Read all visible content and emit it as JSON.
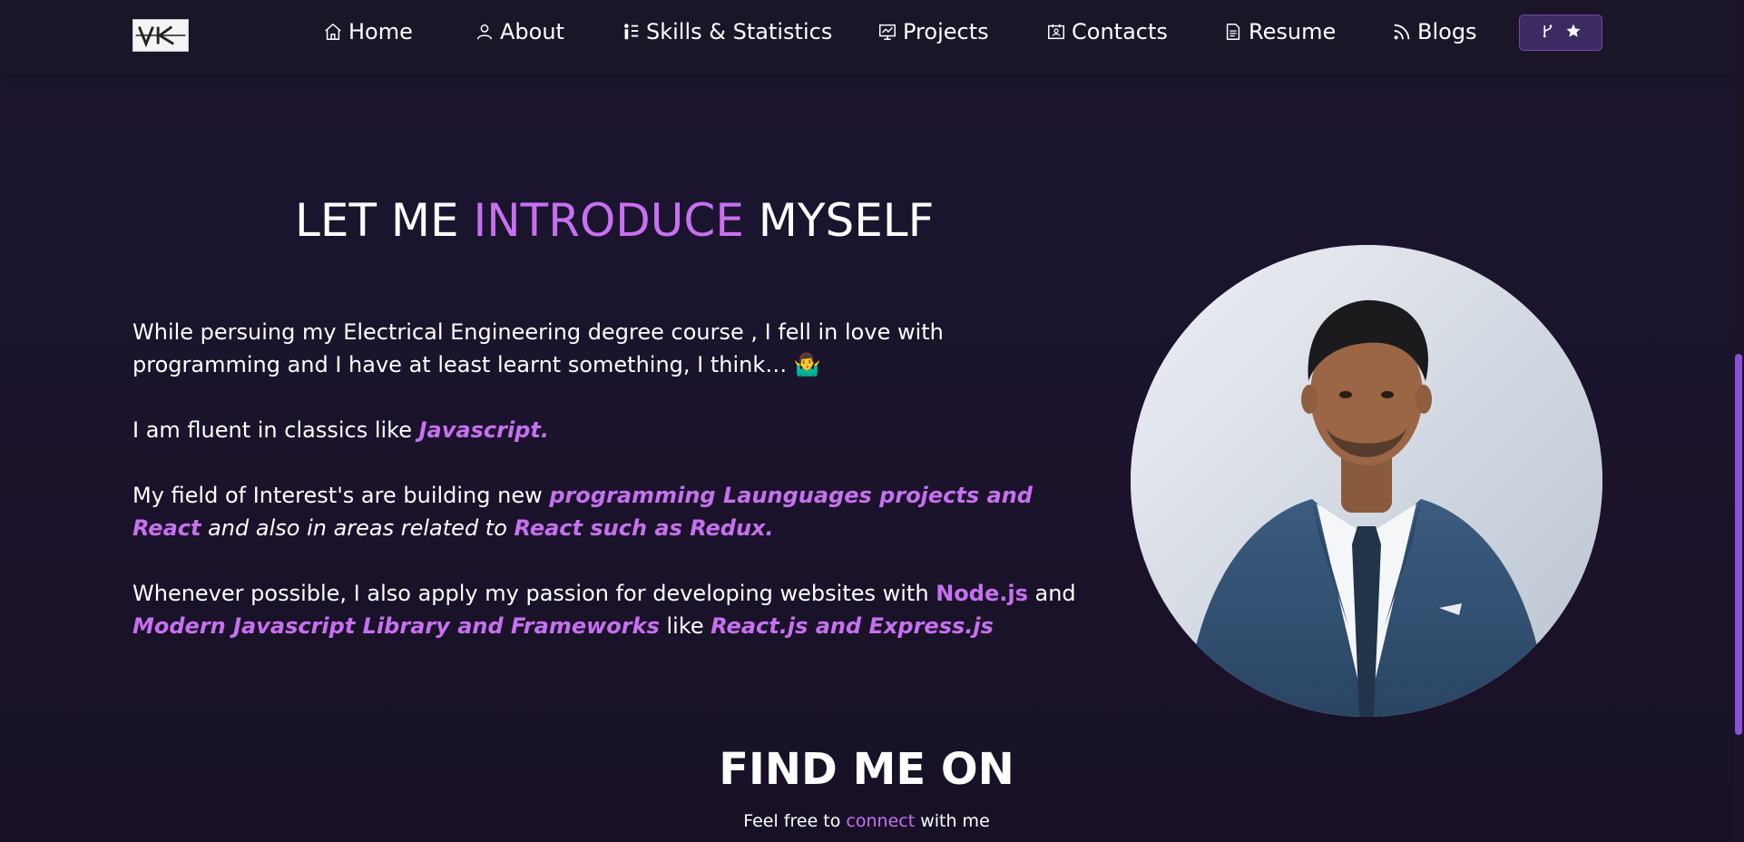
{
  "nav": {
    "home": "Home",
    "about": "About",
    "skills": "Skills & Statistics",
    "projects": "Projects",
    "contacts": "Contacts",
    "resume": "Resume",
    "blogs": "Blogs"
  },
  "intro": {
    "title_part1": "LET ME ",
    "title_highlight": "INTRODUCE",
    "title_part2": " MYSELF",
    "p1": "While persuing my Electrical Engineering degree course , I fell in love with programming and I have at least learnt something, I think… 🤷‍♂️",
    "p2_lead": "I am fluent in classics like ",
    "p2_highlight": "Javascript.",
    "p3_lead": "My field of Interest's are building new ",
    "p3_highlight1": "programming Launguages projects and React",
    "p3_mid": " and also in areas related to ",
    "p3_highlight2": "React such as Redux.",
    "p4_lead": "Whenever possible, I also apply my passion for developing websites with ",
    "p4_node": "Node.js",
    "p4_and": " and ",
    "p4_highlight1": "Modern Javascript Library and Frameworks",
    "p4_like": " like ",
    "p4_highlight2": "React.js and Express.js"
  },
  "find": {
    "title": "FIND ME ON",
    "sub_lead": "Feel free to ",
    "sub_highlight": "connect",
    "sub_tail": " with me"
  },
  "colors": {
    "accent": "#c770f0",
    "background": "#1b1429",
    "navbar": "#1a1628",
    "button": "#3d2a63"
  },
  "icons": [
    "logo",
    "home-icon",
    "user-icon",
    "skills-icon",
    "projects-icon",
    "contacts-icon",
    "resume-icon",
    "blogs-icon",
    "git-branch-icon",
    "star-icon"
  ]
}
